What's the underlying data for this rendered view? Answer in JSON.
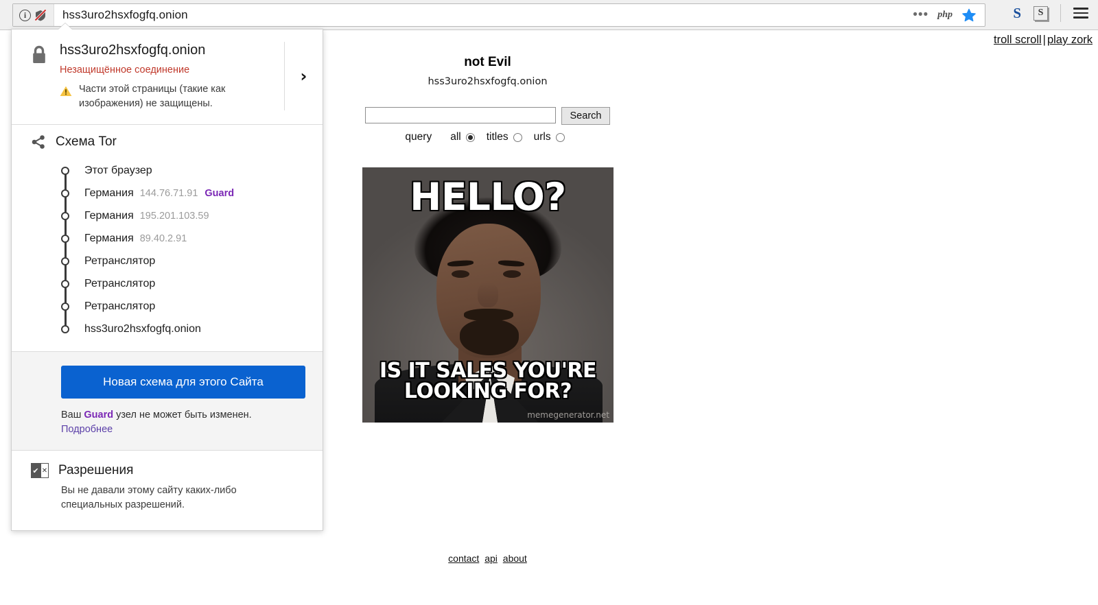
{
  "browser": {
    "url": "hss3uro2hsxfogfq.onion",
    "identity_icon": "info-circle-icon",
    "broken_shield_icon": "broken-shield-icon",
    "more_icon": "ellipsis-icon",
    "php_icon_label": "php",
    "bookmark_icon": "star-icon",
    "extension_s_blue": "S",
    "extension_s_badge": "S",
    "menu_icon": "hamburger-menu-icon",
    "accent_blue": "#0a62d0"
  },
  "identity_panel": {
    "site_host": "hss3uro2hsxfogfq.onion",
    "connection_status": "Незащищённое соединение",
    "connection_status_color": "#c0392b",
    "mixed_content_warning": "Части этой страницы (такие как изображения) не защищены.",
    "expand_chevron": "›",
    "tor_circuit": {
      "title": "Схема Tor",
      "nodes": [
        {
          "label": "Этот браузер",
          "ip": "",
          "role": ""
        },
        {
          "label": "Германия",
          "ip": "144.76.71.91",
          "role": "Guard"
        },
        {
          "label": "Германия",
          "ip": "195.201.103.59",
          "role": ""
        },
        {
          "label": "Германия",
          "ip": "89.40.2.91",
          "role": ""
        },
        {
          "label": "Ретранслятор",
          "ip": "",
          "role": ""
        },
        {
          "label": "Ретранслятор",
          "ip": "",
          "role": ""
        },
        {
          "label": "Ретранслятор",
          "ip": "",
          "role": ""
        },
        {
          "label": "hss3uro2hsxfogfq.onion",
          "ip": "",
          "role": ""
        }
      ],
      "guard_color": "#7b28b5"
    },
    "new_circuit_button": "Новая схема для этого Сайта",
    "guard_note_prefix": "Ваш ",
    "guard_note_bold": "Guard",
    "guard_note_suffix": " узел не может быть изменен.",
    "learn_more": "Подробнее",
    "permissions": {
      "title": "Разрешения",
      "description": "Вы не давали этому сайту каких-либо специальных разрешений."
    }
  },
  "page": {
    "top_links": [
      {
        "label": "troll scroll"
      },
      {
        "label": "play zork"
      }
    ],
    "top_links_separator": "|",
    "site_title": "not Evil",
    "site_domain": "hss3uro2hsxfogfq.onion",
    "search": {
      "value": "",
      "placeholder": "",
      "button_label": "Search",
      "query_label": "query",
      "options": [
        {
          "label": "all",
          "checked": true
        },
        {
          "label": "titles",
          "checked": false
        },
        {
          "label": "urls",
          "checked": false
        }
      ]
    },
    "meme": {
      "top_text": "HELLO?",
      "bottom_text": "IS IT SALES YOU'RE LOOKING FOR?",
      "watermark": "memegenerator.net"
    },
    "footer_links": [
      {
        "label": "contact"
      },
      {
        "label": "api"
      },
      {
        "label": "about"
      }
    ]
  }
}
